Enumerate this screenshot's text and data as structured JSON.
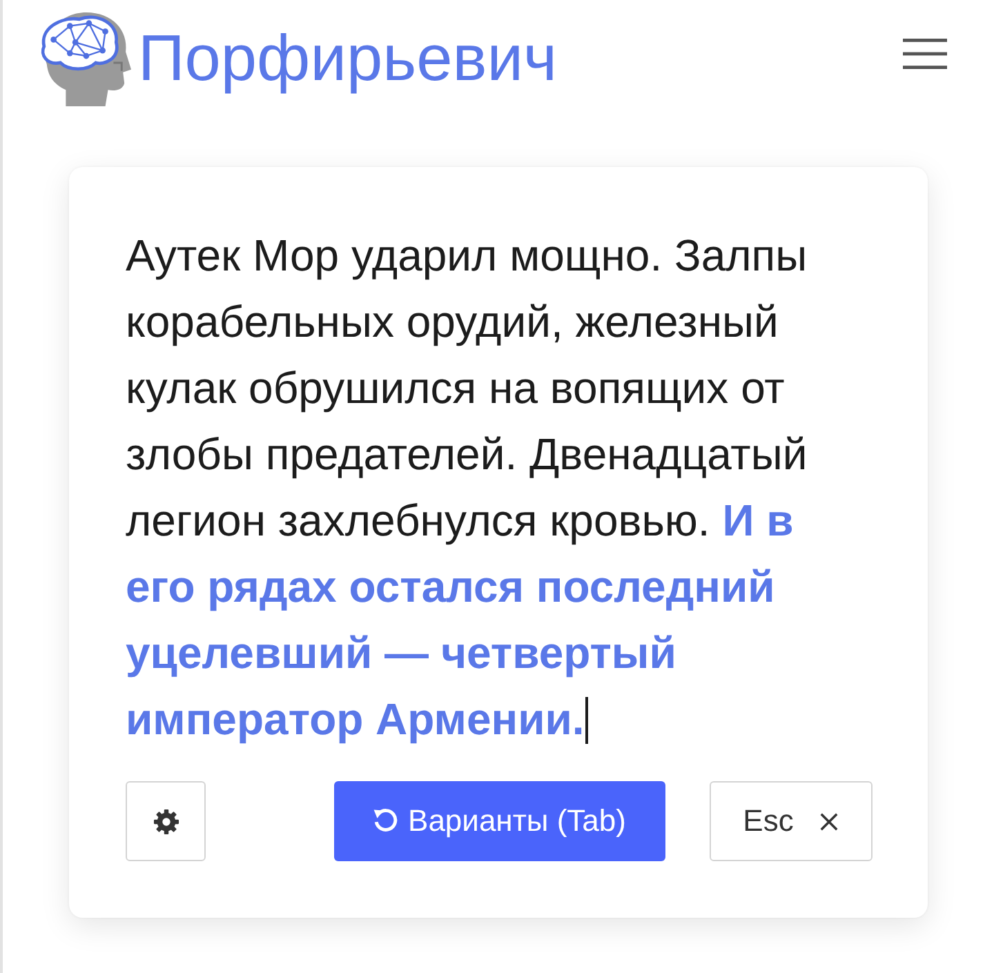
{
  "header": {
    "title": "Порфирьевич"
  },
  "editor": {
    "text": "Аутек Мор ударил мощно. Залпы корабельных орудий, железный кулак обрушился на вопящих от злобы предателей. Двенадцатый легион захлебнулся кровью. **И в его рядах остался последний уцелевший — четвертый император Армении.**",
    "focused": true
  },
  "buttons": [
    {
      "kind": "settings"
    },
    {
      "kind": "variants",
      "label": "Варианты (Tab)"
    },
    {
      "kind": "dismiss",
      "label": "Esc"
    }
  ]
}
